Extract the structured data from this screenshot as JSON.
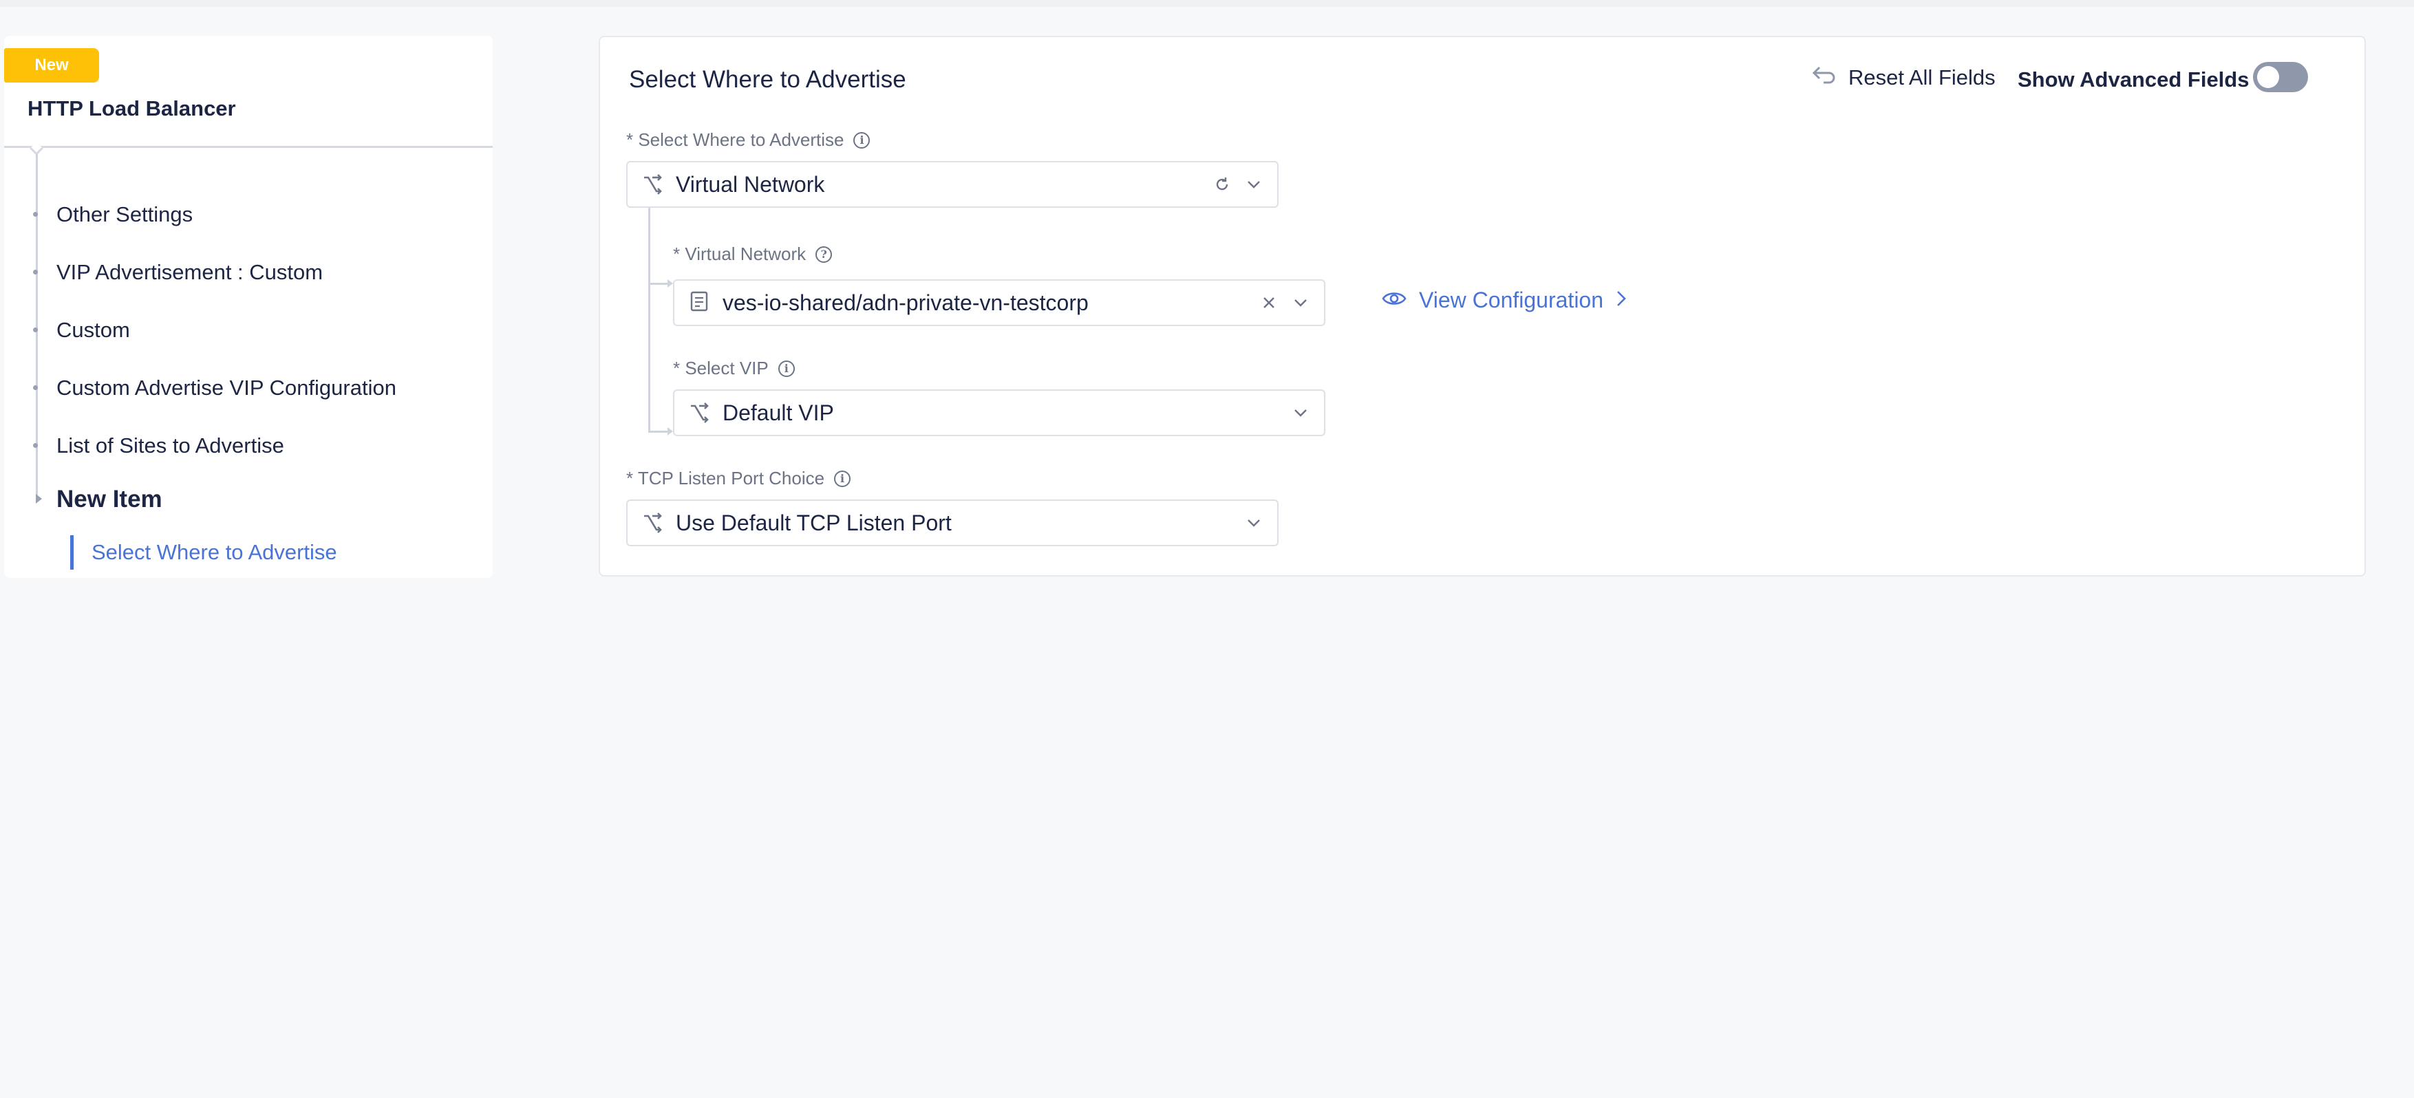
{
  "sidebar": {
    "badge": "New",
    "title": "HTTP Load Balancer",
    "items": [
      {
        "label": "Other Settings"
      },
      {
        "label": "VIP Advertisement : Custom"
      },
      {
        "label": "Custom"
      },
      {
        "label": "Custom Advertise VIP Configuration"
      },
      {
        "label": "List of Sites to Advertise"
      },
      {
        "label": "New Item"
      }
    ],
    "active_item": "Select Where to Advertise"
  },
  "card": {
    "title": "Select Where to Advertise",
    "reset_label": "Reset All Fields",
    "advanced_label": "Show Advanced Fields",
    "advanced_enabled": false
  },
  "fields": {
    "where": {
      "label": "* Select Where to Advertise",
      "value": "Virtual Network"
    },
    "virtual_network": {
      "label": "* Virtual Network",
      "value": "ves-io-shared/adn-private-vn-testcorp",
      "view_config": "View Configuration"
    },
    "vip": {
      "label": "* Select VIP",
      "value": "Default VIP"
    },
    "tcp": {
      "label": "* TCP Listen Port Choice",
      "value": "Use Default TCP Listen Port"
    }
  },
  "colors": {
    "accent": "#4a73d8",
    "badge": "#ffc107",
    "text": "#1d2544",
    "muted": "#6b7385"
  }
}
